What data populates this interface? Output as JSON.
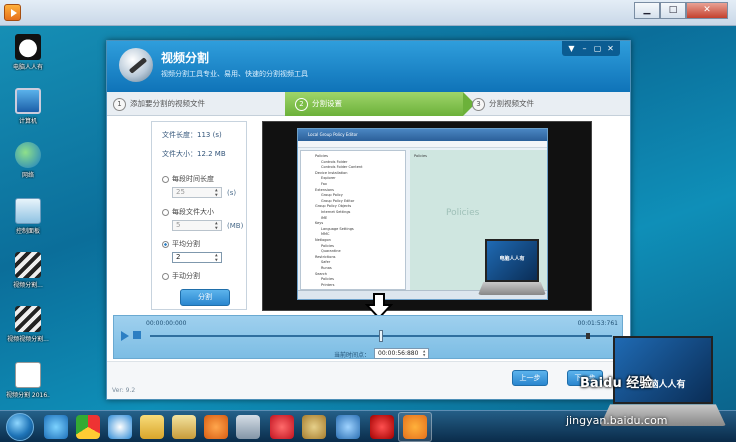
{
  "desktop": {
    "icons": [
      {
        "label": "电脑人人有"
      },
      {
        "label": "计算机"
      },
      {
        "label": "网络"
      },
      {
        "label": "控制面板"
      },
      {
        "label": "视频分割..."
      },
      {
        "label": "视频视频分割..."
      },
      {
        "label": "视频分割 2016..."
      }
    ]
  },
  "outer_window": {
    "controls": {
      "minimize": "▁",
      "maximize": "□",
      "close": "✕"
    }
  },
  "app": {
    "title": "视频分割",
    "subtitle": "视频分割工具专业、易用、快速的分割视频工具",
    "header_controls": {
      "menu": "▼",
      "minimize": "–",
      "maximize": "▢",
      "close": "✕"
    },
    "steps": [
      {
        "num": "1",
        "label": "添加要分割的视频文件"
      },
      {
        "num": "2",
        "label": "分割设置"
      },
      {
        "num": "3",
        "label": "分割视频文件"
      }
    ],
    "file_info": {
      "length_label": "文件长度：",
      "length_value": "113 (s)",
      "size_label": "文件大小：",
      "size_value": "12.2 MB"
    },
    "options": {
      "by_time": {
        "label": "每段时间长度",
        "value": "25",
        "unit": "(s)"
      },
      "by_size": {
        "label": "每段文件大小",
        "value": "5",
        "unit": "(MB)"
      },
      "average": {
        "label": "平均分割",
        "value": "2"
      },
      "manual": {
        "label": "手动分割"
      }
    },
    "split_button": "分割",
    "timeline": {
      "start_time": "00:00:00:000",
      "end_time": "00:01:53:761",
      "current_label": "当前时间点：",
      "current_value": "00:00:56:880",
      "position": 0.5
    },
    "footer": {
      "version": "Ver: 9.2",
      "prev_button": "上一步",
      "next_button": "下一步"
    }
  },
  "preview": {
    "shot_title": "Local Group Policy Editor",
    "tree_items": [
      "Policies",
      "Controls Folder",
      "Controls Folder Content",
      "Device Installation",
      "Explorer",
      "Fax",
      "Extensions",
      "Group Policy",
      "Group Policy Editor",
      "Group Policy Objects",
      "Internet Settings",
      "IME",
      "Keys",
      "Language Settings",
      "MMC",
      "Netlogon",
      "Policies",
      "Quarantine",
      "Restrictions",
      "Safer",
      "Runas",
      "Search",
      "Policies",
      "Printers"
    ],
    "right_items": [
      "Policies"
    ],
    "policies_watermark": "Policies",
    "laptop_caption": "电脑人人有"
  },
  "watermark": {
    "brand": "Baidu 经验",
    "url": "jingyan.baidu.com",
    "laptop_caption": "电脑人人有"
  },
  "colors": {
    "accent": "#2a86cf",
    "active_step": "#7cbd48"
  }
}
